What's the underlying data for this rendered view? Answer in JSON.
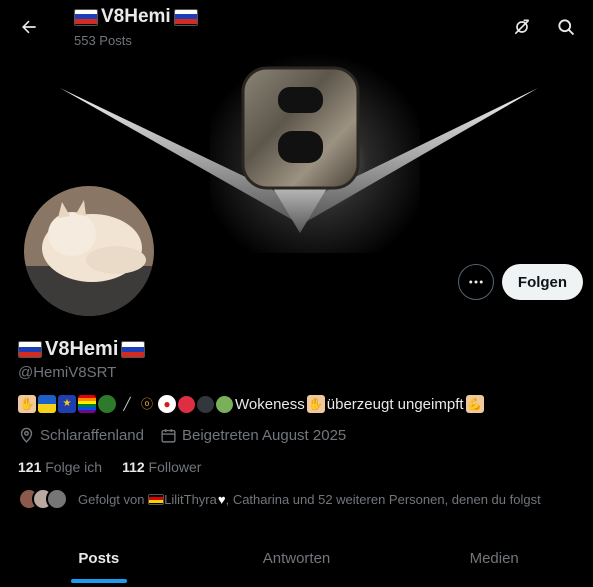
{
  "header": {
    "title": "V8Hemi",
    "posts_count": "553 Posts"
  },
  "profile": {
    "display_name": "V8Hemi",
    "handle": "@HemiV8SRT",
    "bio_text_1": "Wokeness",
    "bio_text_2": "überzeugt ungeimpft",
    "location": "Schlaraffenland",
    "joined": "Beigetreten August 2025",
    "following_count": "121",
    "following_label": "Folge ich",
    "followers_count": "112",
    "followers_label": "Follower",
    "followed_by_prefix": "Gefolgt von",
    "followed_by_name": "LilitThyra",
    "followed_by_rest": ", Catharina und 52 weiteren Personen, denen du folgst"
  },
  "actions": {
    "follow_label": "Folgen"
  },
  "tabs": [
    {
      "label": "Posts",
      "active": true
    },
    {
      "label": "Antworten",
      "active": false
    },
    {
      "label": "Medien",
      "active": false
    }
  ],
  "colors": {
    "accent": "#1d9bf0",
    "muted": "#71767b",
    "background": "#000000"
  },
  "icons": [
    "back-arrow-icon",
    "no-sync-icon",
    "search-icon",
    "more-icon",
    "location-icon",
    "calendar-icon"
  ]
}
